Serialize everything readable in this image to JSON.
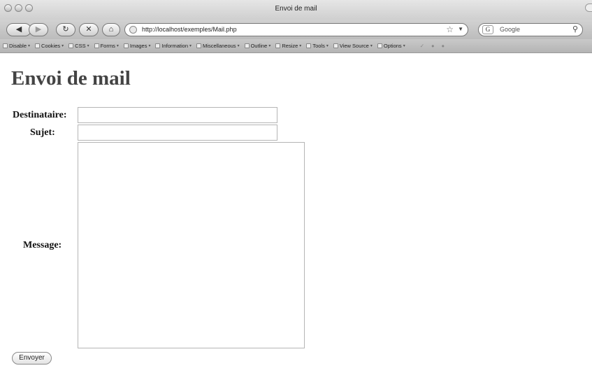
{
  "window": {
    "title": "Envoi de mail"
  },
  "navigation": {
    "back_icon": "back-arrow-icon",
    "forward_icon": "forward-arrow-icon",
    "url": "http://localhost/exemples/Mail.php",
    "search_placeholder": "Google"
  },
  "devtoolbar": {
    "items": [
      {
        "label": "Disable"
      },
      {
        "label": "Cookies"
      },
      {
        "label": "CSS"
      },
      {
        "label": "Forms"
      },
      {
        "label": "Images"
      },
      {
        "label": "Information"
      },
      {
        "label": "Miscellaneous"
      },
      {
        "label": "Outline"
      },
      {
        "label": "Resize"
      },
      {
        "label": "Tools"
      },
      {
        "label": "View Source"
      },
      {
        "label": "Options"
      }
    ]
  },
  "page": {
    "title": "Envoi de mail",
    "labels": {
      "recipient": "Destinataire:",
      "subject": "Sujet:",
      "message": "Message:"
    },
    "values": {
      "recipient": "",
      "subject": "",
      "message": ""
    },
    "submit_label": "Envoyer"
  }
}
